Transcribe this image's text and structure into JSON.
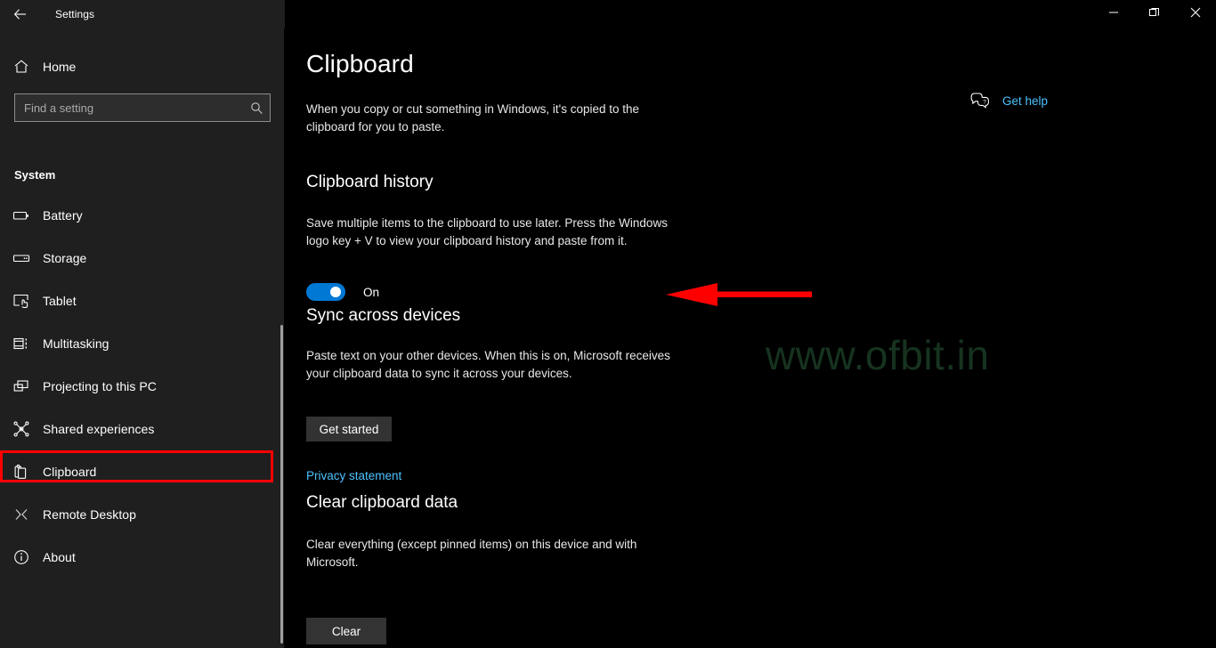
{
  "window": {
    "title": "Settings",
    "back_icon": "back-arrow-icon",
    "controls": {
      "minimize": "minimize-icon",
      "restore": "restore-icon",
      "close": "close-icon"
    }
  },
  "sidebar": {
    "home": {
      "label": "Home",
      "icon": "home-icon"
    },
    "search": {
      "value": "",
      "placeholder": "Find a setting",
      "icon": "search-icon"
    },
    "group_label": "System",
    "items": [
      {
        "label": "Battery",
        "icon": "battery-icon",
        "selected": false
      },
      {
        "label": "Storage",
        "icon": "storage-drive-icon",
        "selected": false
      },
      {
        "label": "Tablet",
        "icon": "tablet-touch-icon",
        "selected": false
      },
      {
        "label": "Multitasking",
        "icon": "multitasking-icon",
        "selected": false
      },
      {
        "label": "Projecting to this PC",
        "icon": "projecting-screens-icon",
        "selected": false
      },
      {
        "label": "Shared experiences",
        "icon": "shared-experiences-icon",
        "selected": false
      },
      {
        "label": "Clipboard",
        "icon": "clipboard-icon",
        "selected": true
      },
      {
        "label": "Remote Desktop",
        "icon": "remote-desktop-icon",
        "selected": false
      },
      {
        "label": "About",
        "icon": "info-circle-icon",
        "selected": false
      }
    ]
  },
  "main": {
    "page_title": "Clipboard",
    "intro": "When you copy or cut something in Windows, it's copied to the clipboard for you to paste.",
    "get_help": {
      "label": "Get help",
      "icon": "help-chat-icon"
    },
    "sections": [
      {
        "heading": "Clipboard history",
        "description": "Save multiple items to the clipboard to use later. Press the Windows logo key + V to view your clipboard history and paste from it.",
        "toggle": {
          "state_label": "On",
          "checked": true
        }
      },
      {
        "heading": "Sync across devices",
        "description": "Paste text on your other devices. When this is on, Microsoft receives your clipboard data to sync it across your devices.",
        "button": "Get started",
        "link": "Privacy statement"
      },
      {
        "heading": "Clear clipboard data",
        "description": "Clear everything (except pinned items) on this device and with Microsoft.",
        "button": "Clear"
      }
    ]
  },
  "watermark": "www.ofbit.in",
  "annotations": {
    "arrow_color": "#ff0000",
    "highlight_color": "#ff0000",
    "arrow_target": "Clipboard history toggle",
    "highlight_target": "Clipboard sidebar item"
  },
  "colors": {
    "accent": "#0078d4",
    "link": "#4cc2ff",
    "sidebar_bg": "#1f1f1f",
    "content_bg": "#000000",
    "button_bg": "#333333",
    "watermark": "#16331f"
  }
}
